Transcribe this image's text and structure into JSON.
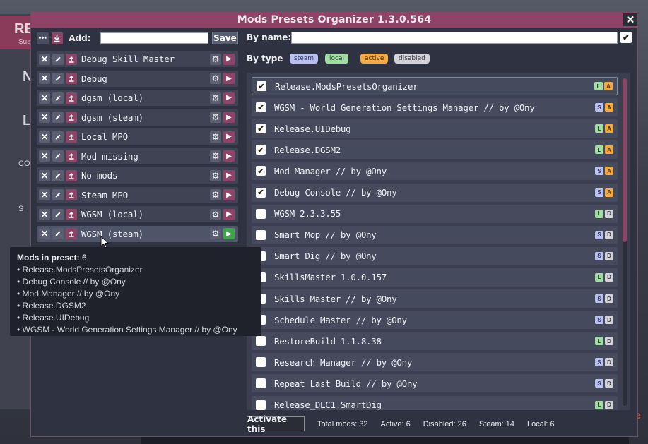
{
  "background": {
    "left_button_text": "RE",
    "left_button_sub": "Sua",
    "left_letters": [
      "N",
      "L"
    ],
    "left_small": [
      "CO",
      "S"
    ],
    "right_red_mark": "e"
  },
  "window": {
    "title": "Mods Presets Organizer 1.3.0.564",
    "close_symbol": "✕"
  },
  "left_toolbar": {
    "menu_symbol": "•••",
    "add_label": "Add:",
    "add_value": "",
    "save_label": "Save"
  },
  "presets": [
    {
      "name": "Debug Skill Master",
      "selected": false
    },
    {
      "name": "Debug",
      "selected": false
    },
    {
      "name": "dgsm (local)",
      "selected": false
    },
    {
      "name": "dgsm (steam)",
      "selected": false
    },
    {
      "name": "Local MPO",
      "selected": false
    },
    {
      "name": "Mod missing",
      "selected": false
    },
    {
      "name": "No mods",
      "selected": false
    },
    {
      "name": "Steam MPO",
      "selected": false
    },
    {
      "name": "WGSM (local)",
      "selected": false
    },
    {
      "name": "WGSM (steam)",
      "selected": true
    }
  ],
  "filter": {
    "by_name_label": "By name:",
    "by_name_value": "",
    "by_type_label": "By type",
    "types": {
      "steam": "steam",
      "local": "local",
      "active": "active",
      "disabled": "disabled"
    }
  },
  "mods": [
    {
      "name": "Release.ModsPresetsOrganizer",
      "checked": true,
      "source": "L",
      "state": "A"
    },
    {
      "name": "WGSM - World Generation Settings Manager // by @Ony",
      "checked": true,
      "source": "S",
      "state": "A"
    },
    {
      "name": "Release.UIDebug",
      "checked": true,
      "source": "L",
      "state": "A"
    },
    {
      "name": "Release.DGSM2",
      "checked": true,
      "source": "L",
      "state": "A"
    },
    {
      "name": "Mod Manager // by @Ony",
      "checked": true,
      "source": "S",
      "state": "A"
    },
    {
      "name": "Debug Console // by @Ony",
      "checked": true,
      "source": "S",
      "state": "A"
    },
    {
      "name": "WGSM 2.3.3.55",
      "checked": false,
      "source": "L",
      "state": "D"
    },
    {
      "name": "Smart Mop // by @Ony",
      "checked": false,
      "source": "S",
      "state": "D"
    },
    {
      "name": "Smart Dig // by @Ony",
      "checked": false,
      "source": "S",
      "state": "D"
    },
    {
      "name": "SkillsMaster 1.0.0.157",
      "checked": false,
      "source": "L",
      "state": "D"
    },
    {
      "name": "Skills Master // by @Ony",
      "checked": false,
      "source": "S",
      "state": "D"
    },
    {
      "name": "Schedule Master // by @Ony",
      "checked": false,
      "source": "S",
      "state": "D"
    },
    {
      "name": "RestoreBuild 1.1.8.38",
      "checked": false,
      "source": "L",
      "state": "D"
    },
    {
      "name": "Research Manager // by @Ony",
      "checked": false,
      "source": "S",
      "state": "D"
    },
    {
      "name": "Repeat Last Build // by @Ony",
      "checked": false,
      "source": "S",
      "state": "D"
    },
    {
      "name": "Release_DLC1.SmartDig",
      "checked": false,
      "source": "L",
      "state": "D"
    }
  ],
  "bottom": {
    "activate_label": "Activate this",
    "total": "Total mods: 32",
    "active": "Active: 6",
    "disabled": "Disabled: 26",
    "steam": "Steam: 14",
    "local": "Local: 6"
  },
  "tooltip": {
    "title_label": "Mods in preset:",
    "count": "6",
    "items": [
      "Release.ModsPresetsOrganizer",
      "Debug Console // by @Ony",
      "Mod Manager // by @Ony",
      "Release.DGSM2",
      "Release.UIDebug",
      "WGSM - World Generation Settings Manager // by @Ony"
    ]
  }
}
